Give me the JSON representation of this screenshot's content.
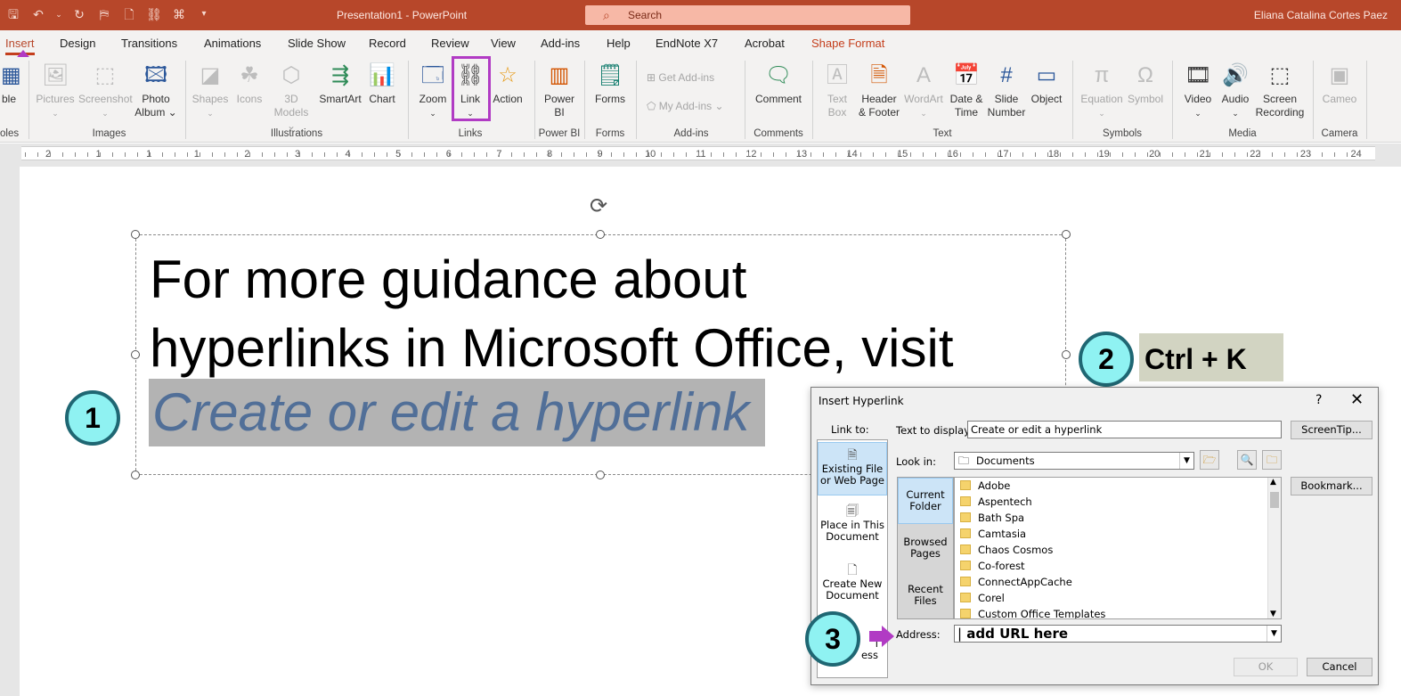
{
  "titlebar": {
    "doc_title": "Presentation1  -  PowerPoint",
    "search_placeholder": "Search",
    "user": "Eliana Catalina Cortes Paez"
  },
  "tabs": [
    "Insert",
    "Design",
    "Transitions",
    "Animations",
    "Slide Show",
    "Record",
    "Review",
    "View",
    "Add-ins",
    "Help",
    "EndNote X7",
    "Acrobat",
    "Shape Format"
  ],
  "ribbon": {
    "table_label": "ble",
    "tables_group": "oles",
    "pictures": "Pictures",
    "screenshot": "Screenshot",
    "photo_album_1": "Photo",
    "photo_album_2": "Album",
    "images_group": "Images",
    "shapes": "Shapes",
    "icons": "Icons",
    "models_1": "3D",
    "models_2": "Models",
    "smartart": "SmartArt",
    "chart": "Chart",
    "illustrations_group": "Illustrations",
    "zoom": "Zoom",
    "link": "Link",
    "action": "Action",
    "links_group": "Links",
    "powerbi_1": "Power",
    "powerbi_2": "BI",
    "powerbi_group": "Power BI",
    "forms": "Forms",
    "forms_group": "Forms",
    "get_addins": "Get Add-ins",
    "my_addins": "My Add-ins",
    "addins_group": "Add-ins",
    "comment": "Comment",
    "comments_group": "Comments",
    "textbox_1": "Text",
    "textbox_2": "Box",
    "header_1": "Header",
    "header_2": "& Footer",
    "wordart": "WordArt",
    "datetime_1": "Date &",
    "datetime_2": "Time",
    "slidenum_1": "Slide",
    "slidenum_2": "Number",
    "object": "Object",
    "text_group": "Text",
    "equation": "Equation",
    "symbol": "Symbol",
    "symbols_group": "Symbols",
    "video": "Video",
    "audio": "Audio",
    "screenrec_1": "Screen",
    "screenrec_2": "Recording",
    "media_group": "Media",
    "cameo": "Cameo",
    "camera_group": "Camera"
  },
  "ruler": {
    "numbers": [
      "2",
      "1",
      "1",
      "1",
      "2",
      "3",
      "4",
      "5",
      "6",
      "7",
      "8",
      "9",
      "10",
      "11",
      "12",
      "13",
      "14",
      "15",
      "16",
      "17",
      "18",
      "19",
      "20",
      "21",
      "22",
      "23",
      "24"
    ]
  },
  "slide": {
    "line1": "For more guidance about",
    "line2": "hyperlinks in Microsoft Office, visit",
    "link_text": "Create or edit a hyperlink"
  },
  "annotations": {
    "step1": "1",
    "step2": "2",
    "step3": "3",
    "shortcut": "Ctrl + K"
  },
  "dialog": {
    "title": "Insert Hyperlink",
    "help": "?",
    "close": "✕",
    "link_to_label": "Link to:",
    "link_to_items": [
      {
        "line1": "Existing File",
        "line2": "or Web Page"
      },
      {
        "line1": "Place in This",
        "line2": "Document"
      },
      {
        "line1": "Create New",
        "line2": "Document"
      },
      {
        "line1": "l",
        "line2": "ess"
      }
    ],
    "text_to_display_label": "Text to display:",
    "text_to_display_value": "Create or edit a hyperlink",
    "screentip_button": "ScreenTip...",
    "look_in_label": "Look in:",
    "look_in_value": "Documents",
    "bookmark_button": "Bookmark...",
    "side_tabs": [
      {
        "line1": "Current",
        "line2": "Folder"
      },
      {
        "line1": "Browsed",
        "line2": "Pages"
      },
      {
        "line1": "Recent",
        "line2": "Files"
      }
    ],
    "files": [
      "Adobe",
      "Aspentech",
      "Bath Spa",
      "Camtasia",
      "Chaos Cosmos",
      "Co-forest",
      "ConnectAppCache",
      "Corel",
      "Custom Office Templates"
    ],
    "address_label": "Address:",
    "address_value": "add URL here",
    "ok_button": "OK",
    "cancel_button": "Cancel"
  },
  "colors": {
    "titlebar": "#b7472a",
    "accent_purple": "#b13bc4",
    "badge_fill": "#8ff2f2",
    "link_text": "#516f98"
  }
}
